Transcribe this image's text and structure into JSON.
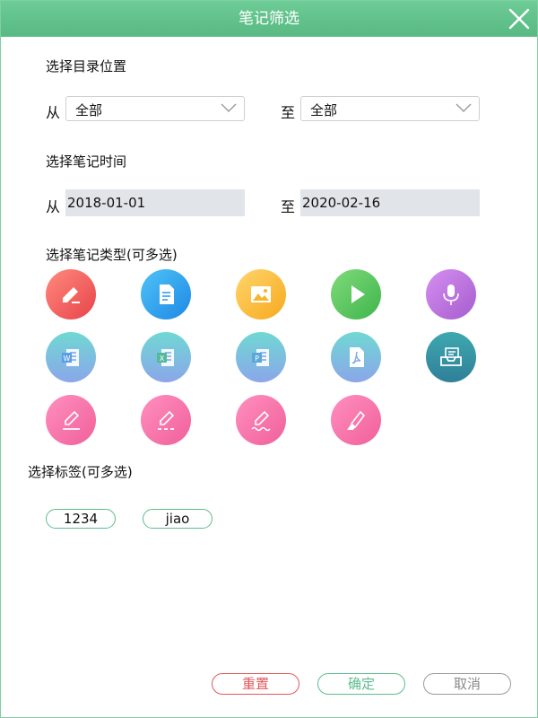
{
  "window": {
    "title": "笔记筛选"
  },
  "directory": {
    "label": "选择目录位置",
    "from_label": "从",
    "from_value": "全部",
    "to_label": "至",
    "to_value": "全部"
  },
  "time": {
    "label": "选择笔记时间",
    "from_label": "从",
    "from_value": "2018-01-01",
    "to_label": "至",
    "to_value": "2020-02-16"
  },
  "types": {
    "label": "选择笔记类型(可多选)",
    "icons": [
      "edit-note-icon",
      "document-icon",
      "image-icon",
      "video-play-icon",
      "microphone-icon",
      "word-icon",
      "excel-icon",
      "powerpoint-icon",
      "pdf-icon",
      "inbox-icon",
      "pen-underline-icon",
      "pen-dashed-icon",
      "pen-wave-icon",
      "highlighter-icon"
    ]
  },
  "tags": {
    "label": "选择标签(可多选)",
    "items": [
      "1234",
      "jiao"
    ]
  },
  "buttons": {
    "reset": "重置",
    "confirm": "确定",
    "cancel": "取消"
  },
  "colors": {
    "accent": "#5bbd8c",
    "reset_border": "#e2585b",
    "reset_text": "#e2585b",
    "confirm_text": "#5bbd8c",
    "cancel_text": "#8a8a8a"
  }
}
